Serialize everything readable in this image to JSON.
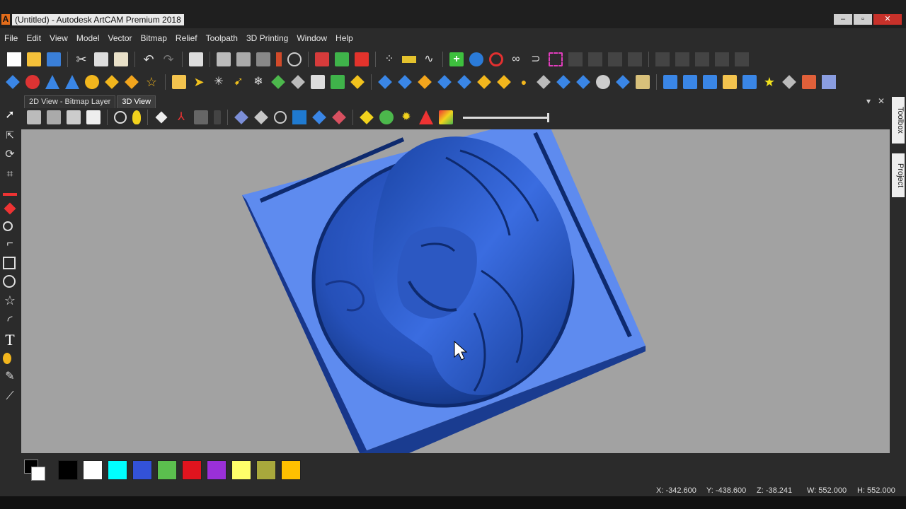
{
  "window": {
    "app_icon": "A",
    "title": "(Untitled) - Autodesk ArtCAM Premium 2018",
    "minimize": "–",
    "maximize": "▫",
    "close": "✕"
  },
  "menu": [
    "File",
    "Edit",
    "View",
    "Model",
    "Vector",
    "Bitmap",
    "Relief",
    "Toolpath",
    "3D Printing",
    "Window",
    "Help"
  ],
  "tabs": {
    "tab_2d": "2D View - Bitmap Layer",
    "tab_3d": "3D View",
    "dropdown": "▾",
    "close": "✕"
  },
  "side_panels": {
    "toolbox": "Toolbox",
    "project": "Project"
  },
  "palette": {
    "colors": [
      "#000000",
      "#ffffff",
      "#00ffff",
      "#3352d8",
      "#5bbf4e",
      "#e0141e",
      "#9a30d8",
      "#ffff6a",
      "#a8a83c",
      "#ffc000"
    ]
  },
  "status": {
    "x": "X: -342.600",
    "y": "Y: -438.600",
    "z": "Z: -38.241",
    "w": "W: 552.000",
    "h": "H: 552.000"
  },
  "colors": {
    "relief_base": "#5e8bef",
    "relief_dark": "#123785",
    "relief_mid": "#2c58c2",
    "viewport_bg": "#a2a2a2"
  }
}
